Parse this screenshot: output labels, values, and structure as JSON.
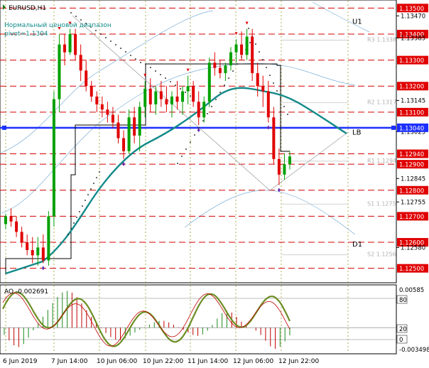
{
  "chart_data": {
    "type": "candlestick",
    "symbol_label": "EURUSD,H1",
    "annotation_lines": [
      "Нормальный ценовой диапазон",
      "pivot=1.1304"
    ],
    "main_panel": {
      "ylim": [
        1.1245,
        1.1352
      ],
      "price_labels": [
        "1.13500",
        "1.13470",
        "1.13400",
        "1.13385",
        "1.13300",
        "1.13200",
        "1.13145",
        "1.13100",
        "1.13025",
        "1.13040",
        "1.12940",
        "1.12900",
        "1.12845",
        "1.12800",
        "1.12755",
        "1.12700",
        "1.12600",
        "1.12580",
        "1.12500"
      ],
      "red_levels": [
        1.135,
        1.134,
        1.133,
        1.132,
        1.131,
        1.1294,
        1.129,
        1.128,
        1.127,
        1.126,
        1.125
      ],
      "red_level_labels": [
        "1.13500",
        "1.13400",
        "1.13300",
        "1.13200",
        "1.13100",
        "1.12940",
        "1.12900",
        "1.12800",
        "1.12700",
        "1.12600",
        "1.12500"
      ],
      "pivot_line": {
        "value": 1.1304,
        "label": "1.13040",
        "color": "#1c2fff",
        "tag": "LB"
      },
      "level_tags": [
        {
          "text": "U1",
          "value": 1.1345
        },
        {
          "text": "LB",
          "value": 1.13025
        },
        {
          "text": "D1",
          "value": 1.12595
        }
      ],
      "faint_labels": [
        {
          "text": "R3 1.1338",
          "value": 1.13385
        },
        {
          "text": "R2 1.1317",
          "value": 1.13145
        },
        {
          "text": "R1 1.1294",
          "value": 1.1292
        },
        {
          "text": "S1 1.1275",
          "value": 1.12755
        },
        {
          "text": "S2 1.1256",
          "value": 1.1256
        }
      ],
      "candles": [
        [
          1.1267,
          1.1271,
          1.1265,
          1.127
        ],
        [
          1.127,
          1.1273,
          1.1266,
          1.1268
        ],
        [
          1.1268,
          1.127,
          1.1262,
          1.1264
        ],
        [
          1.1264,
          1.1266,
          1.1258,
          1.126
        ],
        [
          1.126,
          1.1263,
          1.1255,
          1.1257
        ],
        [
          1.1257,
          1.1262,
          1.1252,
          1.1255
        ],
        [
          1.1255,
          1.1262,
          1.1251,
          1.1258
        ],
        [
          1.1258,
          1.1263,
          1.1252,
          1.1253
        ],
        [
          1.1253,
          1.1272,
          1.1251,
          1.127
        ],
        [
          1.127,
          1.1318,
          1.1266,
          1.1315
        ],
        [
          1.1315,
          1.134,
          1.131,
          1.1336
        ],
        [
          1.1336,
          1.134,
          1.1328,
          1.1333
        ],
        [
          1.1333,
          1.1342,
          1.1332,
          1.134
        ],
        [
          1.134,
          1.1342,
          1.133,
          1.1332
        ],
        [
          1.1332,
          1.1336,
          1.1322,
          1.1326
        ],
        [
          1.1326,
          1.133,
          1.1318,
          1.132
        ],
        [
          1.132,
          1.1322,
          1.1314,
          1.1316
        ],
        [
          1.1316,
          1.1318,
          1.131,
          1.1313
        ],
        [
          1.1313,
          1.1316,
          1.1308,
          1.1311
        ],
        [
          1.1311,
          1.1314,
          1.1306,
          1.1309
        ],
        [
          1.1309,
          1.1312,
          1.1304,
          1.1306
        ],
        [
          1.1306,
          1.1309,
          1.1298,
          1.13
        ],
        [
          1.13,
          1.1303,
          1.1292,
          1.1295
        ],
        [
          1.1295,
          1.1311,
          1.1294,
          1.1308
        ],
        [
          1.1308,
          1.1312,
          1.1298,
          1.1301
        ],
        [
          1.1301,
          1.1314,
          1.1295,
          1.1312
        ],
        [
          1.1312,
          1.1322,
          1.1308,
          1.1319
        ],
        [
          1.1319,
          1.1323,
          1.131,
          1.1313
        ],
        [
          1.1313,
          1.132,
          1.1309,
          1.1318
        ],
        [
          1.1318,
          1.1322,
          1.1312,
          1.1315
        ],
        [
          1.1315,
          1.132,
          1.131,
          1.1313
        ],
        [
          1.1313,
          1.1318,
          1.1308,
          1.1316
        ],
        [
          1.1316,
          1.1322,
          1.1311,
          1.1314
        ],
        [
          1.1314,
          1.132,
          1.1309,
          1.1318
        ],
        [
          1.1318,
          1.1324,
          1.1313,
          1.132
        ],
        [
          1.132,
          1.1322,
          1.1312,
          1.1314
        ],
        [
          1.1314,
          1.1318,
          1.1305,
          1.1308
        ],
        [
          1.1308,
          1.1316,
          1.1306,
          1.1314
        ],
        [
          1.1314,
          1.1331,
          1.1312,
          1.1329
        ],
        [
          1.1329,
          1.1333,
          1.1324,
          1.1327
        ],
        [
          1.1327,
          1.133,
          1.1323,
          1.1325
        ],
        [
          1.1325,
          1.1329,
          1.1322,
          1.1328
        ],
        [
          1.1328,
          1.1335,
          1.1326,
          1.1333
        ],
        [
          1.1333,
          1.1338,
          1.1329,
          1.1336
        ],
        [
          1.1336,
          1.1341,
          1.133,
          1.1332
        ],
        [
          1.1332,
          1.1342,
          1.133,
          1.1339
        ],
        [
          1.1339,
          1.1342,
          1.1322,
          1.1325
        ],
        [
          1.1325,
          1.1329,
          1.1316,
          1.132
        ],
        [
          1.132,
          1.1324,
          1.1312,
          1.1318
        ],
        [
          1.1318,
          1.1322,
          1.1306,
          1.1308
        ],
        [
          1.1308,
          1.1312,
          1.129,
          1.1292
        ],
        [
          1.1292,
          1.1296,
          1.1282,
          1.1286
        ],
        [
          1.1286,
          1.1294,
          1.1284,
          1.129
        ],
        [
          1.129,
          1.1295,
          1.1288,
          1.1293
        ]
      ]
    },
    "ao_panel": {
      "label": "AO -0.002691",
      "ylim": [
        -0.003498,
        0.00585
      ],
      "tick_labels": [
        "0.00585",
        "80",
        "20",
        "0",
        "-0.003498"
      ]
    },
    "x_tick_labels": [
      "6 Jun 2019",
      "7 Jun 14:00",
      "10 Jun 06:00",
      "10 Jun 22:00",
      "11 Jun 14:00",
      "12 Jun 06:00",
      "12 Jun 22:00"
    ]
  }
}
